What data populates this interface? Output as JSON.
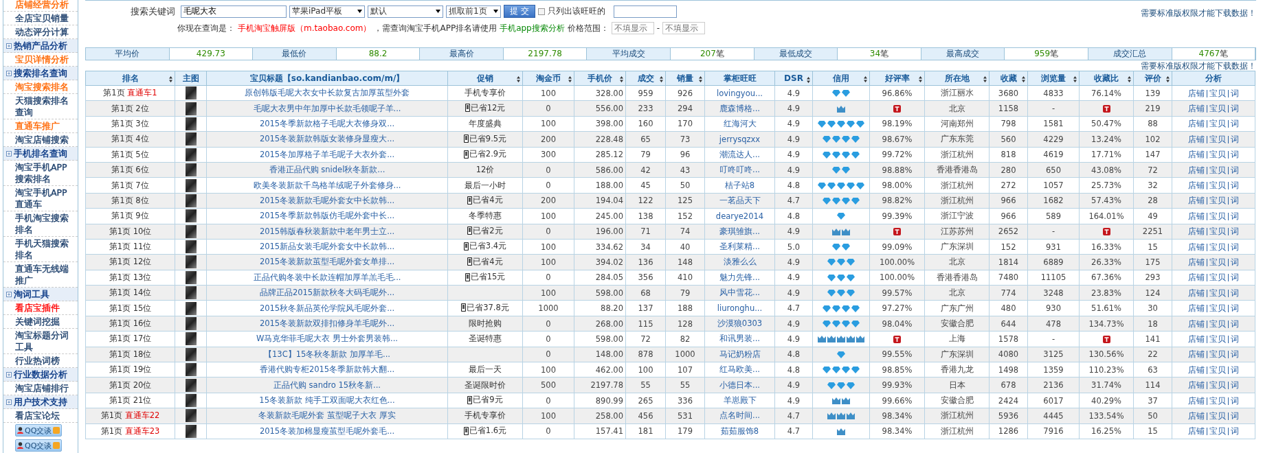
{
  "sidebar": {
    "items": [
      {
        "kind": "link",
        "label": "店铺经营分析",
        "color": "#ff6600"
      },
      {
        "kind": "link",
        "label": "全店宝贝销量",
        "color": "#1d3f6b"
      },
      {
        "kind": "link",
        "label": "动态评分计算",
        "color": "#1d3f6b"
      },
      {
        "kind": "header",
        "label": "热销产品分析"
      },
      {
        "kind": "link",
        "label": "宝贝详情分析",
        "color": "#ff6600"
      },
      {
        "kind": "header",
        "label": "搜索排名查询"
      },
      {
        "kind": "link",
        "label": "淘宝搜索排名",
        "color": "#ff6600"
      },
      {
        "kind": "link",
        "label": "天猫搜索排名查询",
        "color": "#1d3f6b"
      },
      {
        "kind": "link",
        "label": "直通车推广",
        "color": "#ff6600"
      },
      {
        "kind": "link",
        "label": "淘宝店铺搜索",
        "color": "#1d3f6b"
      },
      {
        "kind": "header",
        "label": "手机排名查询"
      },
      {
        "kind": "link",
        "label": "淘宝手机APP搜索排名",
        "color": "#1d3f6b"
      },
      {
        "kind": "link",
        "label": "淘宝手机APP直通车",
        "color": "#1d3f6b"
      },
      {
        "kind": "link",
        "label": "手机淘宝搜索排名",
        "color": "#1d3f6b"
      },
      {
        "kind": "link",
        "label": "手机天猫搜索排名",
        "color": "#1d3f6b"
      },
      {
        "kind": "link",
        "label": "直通车无线端推广",
        "color": "#1d3f6b"
      },
      {
        "kind": "header",
        "label": "淘词工具"
      },
      {
        "kind": "link",
        "label": "看店宝插件",
        "color": "#ff0000"
      },
      {
        "kind": "link",
        "label": "关键词挖掘",
        "color": "#1d3f6b"
      },
      {
        "kind": "link",
        "label": "淘宝标题分词工具",
        "color": "#1d3f6b"
      },
      {
        "kind": "link",
        "label": "行业热词榜",
        "color": "#1d3f6b"
      },
      {
        "kind": "header",
        "label": "行业数据分析"
      },
      {
        "kind": "link",
        "label": "淘宝店铺排行",
        "color": "#1d3f6b"
      },
      {
        "kind": "header",
        "label": "用户技术支持"
      },
      {
        "kind": "link",
        "label": "看店宝论坛",
        "color": "#1d3f6b"
      },
      {
        "kind": "qq",
        "label": "QQ交谈"
      },
      {
        "kind": "qq",
        "label": "QQ交谈"
      }
    ]
  },
  "search": {
    "label": "搜索关键词",
    "value": "毛呢大衣",
    "selects": [
      "苹果iPad平板",
      "默认",
      "抓取前1页"
    ],
    "submit": "提 交",
    "only_label": "只列出该旺旺的",
    "only_checked": false,
    "notice": "需要标准版权限才能下载数据！"
  },
  "query": {
    "prefix": "你现在查询是：",
    "mode": "手机淘宝触屏版（m.taobao.com）",
    "middle": "，需查询淘宝手机APP排名请使用",
    "link": "手机app搜索分析",
    "price_label": "价格范围：",
    "price_min_placeholder": "不填显示",
    "dash": "-",
    "price_max_placeholder": "不填显示"
  },
  "stats": [
    {
      "label": "平均价",
      "value": "429.73"
    },
    {
      "label": "最低价",
      "value": "88.2"
    },
    {
      "label": "最高价",
      "value": "2197.78"
    },
    {
      "label": "平均成交",
      "value": "207",
      "unit": "笔"
    },
    {
      "label": "最低成交",
      "value": "34",
      "unit": "笔"
    },
    {
      "label": "最高成交",
      "value": "959",
      "unit": "笔"
    },
    {
      "label": "成交汇总",
      "value": "4767",
      "unit": "笔"
    }
  ],
  "table_notice": "需要标准版权限才能下载数据！",
  "table": {
    "columns": [
      {
        "label": "排名",
        "sortable": true
      },
      {
        "label": "主图",
        "sortable": false
      },
      {
        "label": "宝贝标题【so.kandianbao.com/m/】",
        "sortable": false
      },
      {
        "label": "促销",
        "sortable": true
      },
      {
        "label": "淘金币",
        "sortable": true
      },
      {
        "label": "手机价",
        "sortable": true
      },
      {
        "label": "成交",
        "sortable": true
      },
      {
        "label": "销量",
        "sortable": true
      },
      {
        "label": "掌柜旺旺",
        "sortable": false
      },
      {
        "label": "DSR",
        "sortable": true
      },
      {
        "label": "信用",
        "sortable": true
      },
      {
        "label": "好评率",
        "sortable": true
      },
      {
        "label": "所在地",
        "sortable": true
      },
      {
        "label": "收藏",
        "sortable": true
      },
      {
        "label": "浏览量",
        "sortable": true
      },
      {
        "label": "收藏比",
        "sortable": true
      },
      {
        "label": "评价",
        "sortable": true
      },
      {
        "label": "分析",
        "sortable": false
      }
    ],
    "rows": [
      {
        "page": "第1页",
        "pos": "直通车1",
        "ad": true,
        "title": "原创韩版毛呢大衣女中长款复古加厚茧型外套",
        "promo": "手机专享价",
        "promo_icon": false,
        "coin": "100",
        "price": "328.00",
        "deal": "959",
        "sales": "926",
        "shop": "lovingyou...",
        "dsr": "4.9",
        "credit": [
          {
            "kind": "diamond"
          },
          {
            "kind": "diamond"
          }
        ],
        "tmall": false,
        "rate": "96.86%",
        "location": "浙江丽水",
        "fav": "3680",
        "views": "4833",
        "fav_ratio": "76.14%",
        "reviews": "139",
        "links": [
          "店铺",
          "宝贝",
          "词"
        ]
      },
      {
        "page": "第1页",
        "pos": "2位",
        "ad": false,
        "title": "毛呢大衣男中年加厚中长款毛领呢子羊...",
        "promo": "已省12元",
        "promo_icon": true,
        "coin": "0",
        "price": "556.00",
        "deal": "233",
        "sales": "294",
        "shop": "鹿森博格...",
        "dsr": "4.9",
        "credit": [
          {
            "kind": "crown"
          }
        ],
        "tmall": true,
        "location": "北京",
        "fav": "1158",
        "views": "-",
        "reviews": "219",
        "links": [
          "店铺",
          "宝贝",
          "词"
        ]
      },
      {
        "page": "第1页",
        "pos": "3位",
        "ad": false,
        "title": "2015冬季新款格子毛呢大衣修身双...",
        "promo": "年度盛典",
        "promo_icon": false,
        "coin": "100",
        "price": "398.00",
        "deal": "160",
        "sales": "170",
        "shop": "红海河大",
        "dsr": "4.9",
        "credit": [
          {
            "kind": "diamond"
          },
          {
            "kind": "diamond"
          },
          {
            "kind": "diamond"
          },
          {
            "kind": "diamond"
          },
          {
            "kind": "diamond"
          }
        ],
        "tmall": false,
        "rate": "98.19%",
        "location": "河南郑州",
        "fav": "798",
        "views": "1581",
        "fav_ratio": "50.47%",
        "reviews": "88",
        "links": [
          "店铺",
          "宝贝",
          "词"
        ]
      },
      {
        "page": "第1页",
        "pos": "4位",
        "ad": false,
        "title": "2015冬装新款韩版女装修身显瘦大...",
        "promo": "已省9.5元",
        "promo_icon": true,
        "coin": "200",
        "price": "228.48",
        "deal": "65",
        "sales": "73",
        "shop": "jerrysqzxx",
        "dsr": "4.9",
        "credit": [
          {
            "kind": "diamond"
          },
          {
            "kind": "diamond"
          },
          {
            "kind": "diamond"
          },
          {
            "kind": "diamond"
          }
        ],
        "tmall": false,
        "rate": "98.67%",
        "location": "广东东莞",
        "fav": "560",
        "views": "4229",
        "fav_ratio": "13.24%",
        "reviews": "102",
        "links": [
          "店铺",
          "宝贝",
          "词"
        ]
      },
      {
        "page": "第1页",
        "pos": "5位",
        "ad": false,
        "title": "2015冬加厚格子羊毛呢子大衣外套...",
        "promo": "已省2.9元",
        "promo_icon": true,
        "coin": "300",
        "price": "285.12",
        "deal": "79",
        "sales": "96",
        "shop": "潮流达人...",
        "dsr": "4.9",
        "credit": [
          {
            "kind": "diamond"
          },
          {
            "kind": "diamond"
          },
          {
            "kind": "diamond"
          },
          {
            "kind": "diamond"
          }
        ],
        "tmall": false,
        "rate": "99.72%",
        "location": "浙江杭州",
        "fav": "818",
        "views": "4619",
        "fav_ratio": "17.71%",
        "reviews": "147",
        "links": [
          "店铺",
          "宝贝",
          "词"
        ]
      },
      {
        "page": "第1页",
        "pos": "6位",
        "ad": false,
        "title": "香港正品代购 snidel秋冬新款...",
        "promo": "12价",
        "promo_icon": false,
        "coin": "0",
        "price": "586.00",
        "deal": "42",
        "sales": "43",
        "shop": "叮咚叮咚...",
        "dsr": "4.9",
        "credit": [
          {
            "kind": "diamond"
          },
          {
            "kind": "diamond"
          }
        ],
        "tmall": false,
        "rate": "98.88%",
        "location": "香港香港岛",
        "fav": "280",
        "views": "650",
        "fav_ratio": "43.08%",
        "reviews": "72",
        "links": [
          "店铺",
          "宝贝",
          "词"
        ]
      },
      {
        "page": "第1页",
        "pos": "7位",
        "ad": false,
        "title": "欧美冬装新款千鸟格羊绒呢子外套修身...",
        "promo": "最后一小时",
        "promo_icon": false,
        "coin": "0",
        "price": "188.00",
        "deal": "45",
        "sales": "50",
        "shop": "桔子站8",
        "dsr": "4.8",
        "credit": [
          {
            "kind": "diamond"
          },
          {
            "kind": "diamond"
          },
          {
            "kind": "diamond"
          },
          {
            "kind": "diamond"
          },
          {
            "kind": "diamond"
          }
        ],
        "tmall": false,
        "rate": "98.00%",
        "location": "浙江杭州",
        "fav": "272",
        "views": "1057",
        "fav_ratio": "25.73%",
        "reviews": "32",
        "links": [
          "店铺",
          "宝贝",
          "词"
        ]
      },
      {
        "page": "第1页",
        "pos": "8位",
        "ad": false,
        "title": "2015冬装新款毛呢外套女中长款韩...",
        "promo": "已省4元",
        "promo_icon": true,
        "coin": "200",
        "price": "194.04",
        "deal": "122",
        "sales": "125",
        "shop": "一茗品天下",
        "dsr": "4.7",
        "credit": [
          {
            "kind": "diamond"
          },
          {
            "kind": "diamond"
          },
          {
            "kind": "diamond"
          },
          {
            "kind": "diamond"
          }
        ],
        "tmall": false,
        "rate": "98.82%",
        "location": "浙江杭州",
        "fav": "966",
        "views": "1682",
        "fav_ratio": "57.43%",
        "reviews": "28",
        "links": [
          "店铺",
          "宝贝",
          "词"
        ]
      },
      {
        "page": "第1页",
        "pos": "9位",
        "ad": false,
        "title": "2015冬季新款韩版仿毛呢外套中长...",
        "promo": "冬季特惠",
        "promo_icon": false,
        "coin": "100",
        "price": "245.00",
        "deal": "138",
        "sales": "152",
        "shop": "dearye2014",
        "dsr": "4.8",
        "credit": [
          {
            "kind": "diamond"
          }
        ],
        "tmall": false,
        "rate": "99.39%",
        "location": "浙江宁波",
        "fav": "966",
        "views": "589",
        "fav_ratio": "164.01%",
        "reviews": "49",
        "links": [
          "店铺",
          "宝贝",
          "词"
        ]
      },
      {
        "page": "第1页",
        "pos": "10位",
        "ad": false,
        "title": "2015韩版春秋装新款中老年男士立...",
        "promo": "已省2元",
        "promo_icon": true,
        "coin": "0",
        "price": "196.00",
        "deal": "71",
        "sales": "74",
        "shop": "豪琪雏旗...",
        "dsr": "4.9",
        "credit": [
          {
            "kind": "crown"
          },
          {
            "kind": "crown"
          }
        ],
        "tmall": true,
        "location": "江苏苏州",
        "fav": "2652",
        "views": "-",
        "reviews": "2251",
        "links": [
          "店铺",
          "宝贝",
          "词"
        ]
      },
      {
        "page": "第1页",
        "pos": "11位",
        "ad": false,
        "title": "2015新品女装毛呢外套女中长款韩...",
        "promo": "已省3.4元",
        "promo_icon": true,
        "coin": "100",
        "price": "334.62",
        "deal": "34",
        "sales": "40",
        "shop": "圣利莱精...",
        "dsr": "5.0",
        "credit": [
          {
            "kind": "diamond"
          },
          {
            "kind": "diamond"
          }
        ],
        "tmall": false,
        "rate": "99.09%",
        "location": "广东深圳",
        "fav": "152",
        "views": "931",
        "fav_ratio": "16.33%",
        "reviews": "15",
        "links": [
          "店铺",
          "宝贝",
          "词"
        ]
      },
      {
        "page": "第1页",
        "pos": "12位",
        "ad": false,
        "title": "2015冬装新款茧型毛呢外套女单排...",
        "promo": "已省4元",
        "promo_icon": true,
        "coin": "100",
        "price": "394.02",
        "deal": "136",
        "sales": "148",
        "shop": "淡雅么么",
        "dsr": "4.9",
        "credit": [
          {
            "kind": "diamond"
          },
          {
            "kind": "diamond"
          },
          {
            "kind": "diamond"
          }
        ],
        "tmall": false,
        "rate": "100.00%",
        "location": "北京",
        "fav": "1814",
        "views": "6889",
        "fav_ratio": "26.33%",
        "reviews": "175",
        "links": [
          "店铺",
          "宝贝",
          "词"
        ]
      },
      {
        "page": "第1页",
        "pos": "13位",
        "ad": false,
        "title": "正品代购冬装中长款连帽加厚羊羔毛毛...",
        "promo": "已省15元",
        "promo_icon": true,
        "coin": "0",
        "price": "284.05",
        "deal": "356",
        "sales": "410",
        "shop": "魅力先锋...",
        "dsr": "4.9",
        "credit": [
          {
            "kind": "diamond"
          },
          {
            "kind": "diamond"
          },
          {
            "kind": "diamond"
          }
        ],
        "tmall": false,
        "rate": "100.00%",
        "location": "香港香港岛",
        "fav": "7480",
        "views": "11105",
        "fav_ratio": "67.36%",
        "reviews": "293",
        "links": [
          "店铺",
          "宝贝",
          "词"
        ]
      },
      {
        "page": "第1页",
        "pos": "14位",
        "ad": false,
        "title": "品牌正品2015新款秋冬大码毛呢外...",
        "promo_icon": false,
        "coin": "100",
        "price": "598.00",
        "deal": "68",
        "sales": "79",
        "shop": "风中雪花...",
        "dsr": "4.9",
        "credit": [
          {
            "kind": "diamond"
          },
          {
            "kind": "diamond"
          },
          {
            "kind": "diamond"
          }
        ],
        "tmall": false,
        "rate": "99.57%",
        "location": "北京",
        "fav": "774",
        "views": "3248",
        "fav_ratio": "23.83%",
        "reviews": "124",
        "links": [
          "店铺",
          "宝贝",
          "词"
        ]
      },
      {
        "page": "第1页",
        "pos": "15位",
        "ad": false,
        "title": "2015秋冬新品英伦学院风毛呢外套...",
        "promo": "已省37.8元",
        "promo_icon": true,
        "coin": "1000",
        "price": "88.20",
        "deal": "137",
        "sales": "188",
        "shop": "liuronghu...",
        "dsr": "4.7",
        "credit": [
          {
            "kind": "diamond"
          },
          {
            "kind": "diamond"
          },
          {
            "kind": "diamond"
          },
          {
            "kind": "diamond"
          }
        ],
        "tmall": false,
        "rate": "97.27%",
        "location": "广东广州",
        "fav": "480",
        "views": "930",
        "fav_ratio": "51.61%",
        "reviews": "30",
        "links": [
          "店铺",
          "宝贝",
          "词"
        ]
      },
      {
        "page": "第1页",
        "pos": "16位",
        "ad": false,
        "title": "2015冬装新款双排扣修身羊毛呢外...",
        "promo": "限时抢购",
        "promo_icon": false,
        "coin": "0",
        "price": "268.00",
        "deal": "115",
        "sales": "128",
        "shop": "沙漠狼0303",
        "dsr": "4.9",
        "credit": [
          {
            "kind": "diamond"
          },
          {
            "kind": "diamond"
          },
          {
            "kind": "diamond"
          },
          {
            "kind": "diamond"
          }
        ],
        "tmall": false,
        "rate": "98.04%",
        "location": "安徽合肥",
        "fav": "644",
        "views": "478",
        "fav_ratio": "134.73%",
        "reviews": "18",
        "links": [
          "店铺",
          "宝贝",
          "词"
        ]
      },
      {
        "page": "第1页",
        "pos": "17位",
        "ad": false,
        "title": "W马克华菲毛呢大衣 男士外套男装韩...",
        "promo": "圣诞特惠",
        "promo_icon": false,
        "coin": "0",
        "price": "598.00",
        "deal": "72",
        "sales": "82",
        "shop": "和讯男装...",
        "dsr": "4.9",
        "credit": [
          {
            "kind": "crown"
          },
          {
            "kind": "crown"
          },
          {
            "kind": "crown"
          },
          {
            "kind": "crown"
          },
          {
            "kind": "crown"
          }
        ],
        "tmall": true,
        "location": "上海",
        "fav": "1578",
        "views": "-",
        "reviews": "141",
        "links": [
          "店铺",
          "宝贝",
          "词"
        ]
      },
      {
        "page": "第1页",
        "pos": "18位",
        "ad": false,
        "title": "【13C】15冬秋冬新款 加厚羊毛...",
        "promo_icon": false,
        "coin": "0",
        "price": "148.00",
        "deal": "878",
        "sales": "1000",
        "shop": "马记奶粉店",
        "dsr": "4.8",
        "credit": [
          {
            "kind": "diamond"
          }
        ],
        "tmall": false,
        "rate": "99.55%",
        "location": "广东深圳",
        "fav": "4080",
        "views": "3125",
        "fav_ratio": "130.56%",
        "reviews": "22",
        "links": [
          "店铺",
          "宝贝",
          "词"
        ]
      },
      {
        "page": "第1页",
        "pos": "19位",
        "ad": false,
        "title": "香港代购专柜2015冬季新款韩大翻...",
        "promo": "最后一天",
        "promo_icon": false,
        "coin": "100",
        "price": "462.00",
        "deal": "100",
        "sales": "107",
        "shop": "红马欧美...",
        "dsr": "4.8",
        "credit": [
          {
            "kind": "diamond"
          },
          {
            "kind": "diamond"
          },
          {
            "kind": "diamond"
          },
          {
            "kind": "diamond"
          }
        ],
        "tmall": false,
        "rate": "98.85%",
        "location": "香港九龙",
        "fav": "1498",
        "views": "1359",
        "fav_ratio": "110.23%",
        "reviews": "63",
        "links": [
          "店铺",
          "宝贝",
          "词"
        ]
      },
      {
        "page": "第1页",
        "pos": "20位",
        "ad": false,
        "title": "正品代购 sandro 15秋冬新...",
        "promo": "圣诞限时价",
        "promo_icon": false,
        "coin": "500",
        "price": "2197.78",
        "deal": "55",
        "sales": "55",
        "shop": "小德日本...",
        "dsr": "4.9",
        "credit": [
          {
            "kind": "diamond"
          },
          {
            "kind": "diamond"
          },
          {
            "kind": "diamond"
          }
        ],
        "tmall": false,
        "rate": "99.93%",
        "location": "日本",
        "fav": "678",
        "views": "2136",
        "fav_ratio": "31.74%",
        "reviews": "114",
        "links": [
          "店铺",
          "宝贝",
          "词"
        ]
      },
      {
        "page": "第1页",
        "pos": "21位",
        "ad": false,
        "title": "15冬装新款 纯手工双面呢大衣红色...",
        "promo": "已省9元",
        "promo_icon": true,
        "coin": "0",
        "price": "890.99",
        "deal": "265",
        "sales": "336",
        "shop": "羊崽殿下",
        "dsr": "4.9",
        "credit": [
          {
            "kind": "crown"
          },
          {
            "kind": "crown"
          }
        ],
        "tmall": false,
        "rate": "99.66%",
        "location": "安徽合肥",
        "fav": "2424",
        "views": "6017",
        "fav_ratio": "40.29%",
        "reviews": "37",
        "links": [
          "店铺",
          "宝贝",
          "词"
        ]
      },
      {
        "page": "第1页",
        "pos": "直通车22",
        "ad": true,
        "title": "冬装新款毛呢外套 茧型呢子大衣 厚实",
        "promo": "手机专享价",
        "promo_icon": false,
        "coin": "100",
        "price": "258.00",
        "deal": "456",
        "sales": "531",
        "shop": "点名时间...",
        "dsr": "4.7",
        "credit": [
          {
            "kind": "crown"
          },
          {
            "kind": "crown"
          },
          {
            "kind": "crown"
          }
        ],
        "tmall": false,
        "rate": "98.34%",
        "location": "浙江杭州",
        "fav": "5936",
        "views": "4445",
        "fav_ratio": "133.54%",
        "reviews": "50",
        "links": [
          "店铺",
          "宝贝",
          "词"
        ]
      },
      {
        "page": "第1页",
        "pos": "直通车23",
        "ad": true,
        "title": "2015冬装加棉显瘦茧型毛呢外套毛...",
        "promo": "已省1.6元",
        "promo_icon": true,
        "coin": "0",
        "price": "157.41",
        "deal": "181",
        "sales": "179",
        "shop": "茹茹服饰8",
        "dsr": "4.7",
        "credit": [
          {
            "kind": "crown"
          }
        ],
        "tmall": false,
        "rate": "98.34%",
        "location": "浙江杭州",
        "fav": "1286",
        "views": "7916",
        "fav_ratio": "16.25%",
        "reviews": "15",
        "links": [
          "店铺",
          "宝贝",
          "词"
        ]
      }
    ]
  }
}
